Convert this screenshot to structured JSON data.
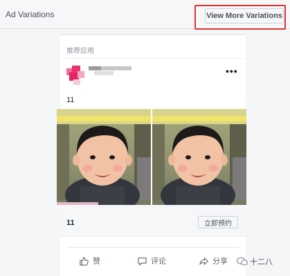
{
  "header": {
    "title": "Ad Variations",
    "view_more_label": "View More Variations"
  },
  "ad": {
    "sponsored_label": "推荐应用",
    "post_text": "11",
    "caption_title": "11",
    "cta_label": "立即预约",
    "more_icon": "more-horizontal-icon"
  },
  "actions": {
    "like_label": "赞",
    "comment_label": "评论",
    "share_label": "分享"
  },
  "watermark": {
    "label": "十二八"
  },
  "colors": {
    "highlight": "#e03131",
    "avatar_accent": "#e8336d"
  }
}
